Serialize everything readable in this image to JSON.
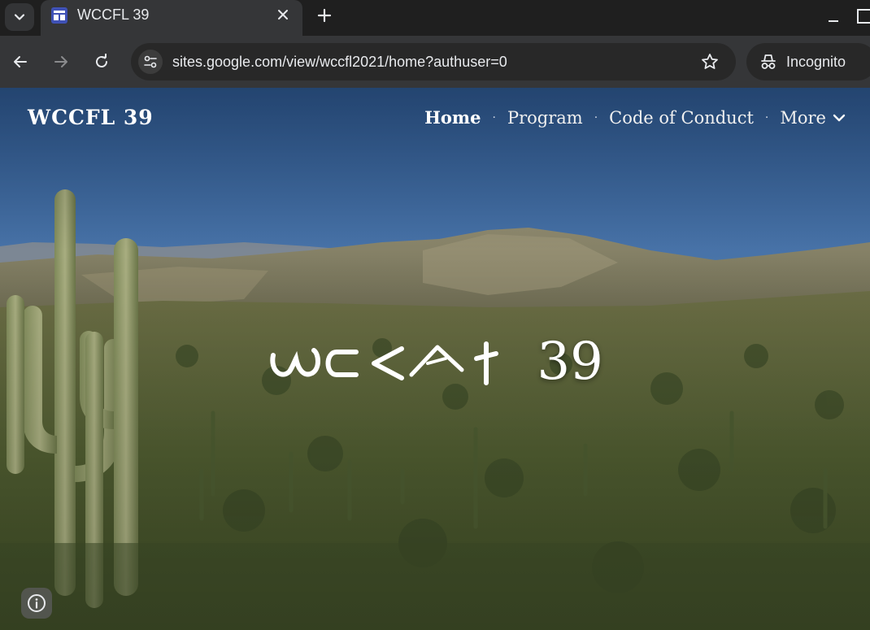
{
  "browser": {
    "tab": {
      "title": "WCCFL 39",
      "favicon": "google-sites-icon"
    },
    "url": "sites.google.com/view/wccfl2021/home?authuser=0",
    "incognito_label": "Incognito",
    "icons": {
      "tab_menu": "chevron-down-icon",
      "close_tab": "close-icon",
      "new_tab": "plus-icon",
      "back": "arrow-left-icon",
      "forward": "arrow-right-icon",
      "reload": "reload-icon",
      "site_info": "tune-icon",
      "bookmark": "star-icon",
      "incognito": "incognito-icon"
    }
  },
  "site": {
    "title": "WCCFL 39",
    "nav": [
      {
        "label": "Home",
        "active": true
      },
      {
        "label": "Program",
        "active": false
      },
      {
        "label": "Code of Conduct",
        "active": false
      },
      {
        "label": "More",
        "active": false
      }
    ],
    "nav_separator": "·",
    "hero": {
      "script_text": "ᨆᨅᨂᨗᨀ",
      "number": "39"
    },
    "info_icon": "info-icon"
  },
  "colors": {
    "chrome_dark": "#1f1f1f",
    "chrome_tab": "#353638",
    "omnibox": "#282828",
    "favicon": "#3f51b5",
    "text_light": "#e8eaed"
  }
}
